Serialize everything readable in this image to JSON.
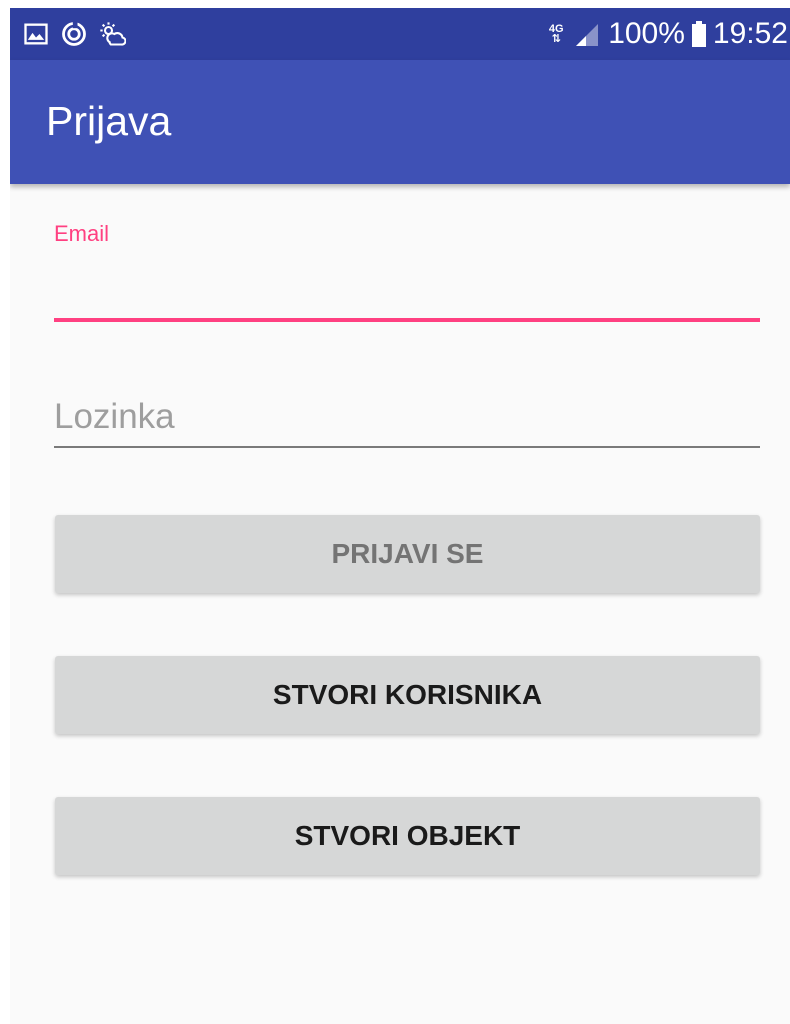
{
  "status_bar": {
    "icons_left": [
      "image-icon",
      "sync-icon",
      "sun-cloud-icon"
    ],
    "network": "4G",
    "battery": "100%",
    "time": "19:52"
  },
  "app_bar": {
    "title": "Prijava"
  },
  "form": {
    "email_label": "Email",
    "email_value": "",
    "password_placeholder": "Lozinka",
    "password_value": ""
  },
  "buttons": {
    "login": "PRIJAVI SE",
    "create_user": "STVORI KORISNIKA",
    "create_object": "STVORI OBJEKT"
  },
  "colors": {
    "status_bar": "#2f3f9e",
    "app_bar": "#3f51b5",
    "accent": "#ff4081",
    "button_bg": "#d6d7d7",
    "disabled_text": "#747474"
  }
}
